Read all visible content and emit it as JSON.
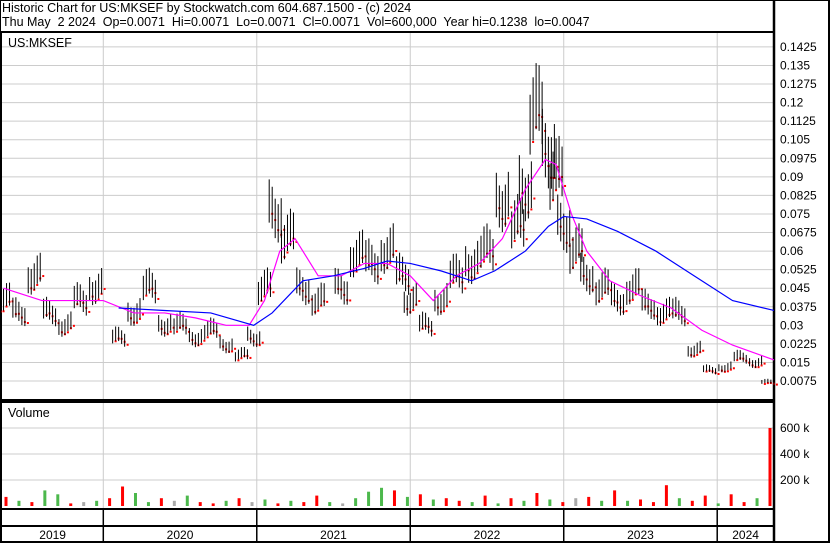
{
  "header": {
    "line1": "Historic Chart for US:MKSEF by Stockwatch.com 604.687.1500 - (c) 2024",
    "line2": "Thu May  2 2024  Op=0.0071  Hi=0.0071  Lo=0.0071  Cl=0.0071  Vol=600,000  Year hi=0.1238  lo=0.0047"
  },
  "chart_data": {
    "type": "line",
    "title": "US:MKSEF",
    "volume_title": "Volume",
    "x_range": [
      2019.34,
      2024.37
    ],
    "years": [
      "2019",
      "2020",
      "2021",
      "2022",
      "2023",
      "2024"
    ],
    "year_starts": [
      2020,
      2021,
      2022,
      2023,
      2024
    ],
    "y_range": [
      0,
      0.15
    ],
    "y_ticks": [
      "0.1425",
      "0.135",
      "0.1275",
      "0.12",
      "0.1125",
      "0.105",
      "0.0975",
      "0.09",
      "0.0825",
      "0.075",
      "0.0675",
      "0.06",
      "0.0525",
      "0.045",
      "0.0375",
      "0.03",
      "0.0225",
      "0.015",
      "0.0075"
    ],
    "volume_ticks": [
      "600 k",
      "400 k",
      "200 k"
    ],
    "volume_tick_values": [
      600,
      400,
      200
    ],
    "price": {
      "x": [
        2019.35,
        2019.45,
        2019.55,
        2019.65,
        2019.75,
        2019.85,
        2019.95,
        2020.1,
        2020.2,
        2020.3,
        2020.4,
        2020.5,
        2020.6,
        2020.7,
        2020.8,
        2020.9,
        2020.98,
        2021.05,
        2021.12,
        2021.2,
        2021.3,
        2021.4,
        2021.55,
        2021.65,
        2021.75,
        2021.85,
        2021.95,
        2022.0,
        2022.1,
        2022.2,
        2022.3,
        2022.4,
        2022.5,
        2022.6,
        2022.7,
        2022.75,
        2022.82,
        2022.9,
        2022.95,
        2023.0,
        2023.08,
        2023.15,
        2023.25,
        2023.35,
        2023.45,
        2023.55,
        2023.65,
        2023.75,
        2023.85,
        2023.95,
        2024.05,
        2024.15,
        2024.25,
        2024.33
      ],
      "close": [
        0.04,
        0.035,
        0.05,
        0.035,
        0.03,
        0.04,
        0.045,
        0.025,
        0.035,
        0.045,
        0.03,
        0.03,
        0.025,
        0.028,
        0.022,
        0.018,
        0.025,
        0.045,
        0.075,
        0.065,
        0.045,
        0.04,
        0.045,
        0.058,
        0.055,
        0.06,
        0.05,
        0.04,
        0.03,
        0.04,
        0.05,
        0.055,
        0.06,
        0.08,
        0.07,
        0.085,
        0.115,
        0.1,
        0.09,
        0.07,
        0.06,
        0.05,
        0.045,
        0.04,
        0.045,
        0.038,
        0.035,
        0.035,
        0.02,
        0.012,
        0.013,
        0.017,
        0.015,
        0.0071
      ]
    },
    "ma_short": {
      "color": "#ff00ff",
      "x": [
        2019.35,
        2019.6,
        2019.8,
        2020.0,
        2020.2,
        2020.4,
        2020.6,
        2020.8,
        2020.95,
        2021.05,
        2021.15,
        2021.25,
        2021.4,
        2021.55,
        2021.7,
        2021.85,
        2022.0,
        2022.15,
        2022.3,
        2022.45,
        2022.6,
        2022.75,
        2022.88,
        2022.95,
        2023.05,
        2023.15,
        2023.3,
        2023.5,
        2023.7,
        2023.9,
        2024.1,
        2024.37
      ],
      "y": [
        0.045,
        0.04,
        0.04,
        0.04,
        0.035,
        0.035,
        0.033,
        0.03,
        0.03,
        0.04,
        0.06,
        0.065,
        0.05,
        0.05,
        0.055,
        0.055,
        0.05,
        0.04,
        0.05,
        0.055,
        0.065,
        0.085,
        0.097,
        0.095,
        0.075,
        0.06,
        0.048,
        0.042,
        0.037,
        0.028,
        0.022,
        0.016
      ]
    },
    "ma_long": {
      "color": "#0000ff",
      "x": [
        2020.1,
        2020.4,
        2020.7,
        2020.98,
        2021.1,
        2021.3,
        2021.5,
        2021.7,
        2021.85,
        2022.0,
        2022.2,
        2022.4,
        2022.55,
        2022.75,
        2022.9,
        2023.0,
        2023.15,
        2023.35,
        2023.6,
        2023.85,
        2024.1,
        2024.37
      ],
      "y": [
        0.037,
        0.036,
        0.035,
        0.03,
        0.035,
        0.048,
        0.05,
        0.053,
        0.056,
        0.055,
        0.052,
        0.048,
        0.052,
        0.06,
        0.07,
        0.074,
        0.073,
        0.068,
        0.06,
        0.05,
        0.04,
        0.036
      ]
    },
    "volume_k": [
      70,
      40,
      30,
      120,
      90,
      20,
      30,
      40,
      60,
      150,
      100,
      30,
      60,
      40,
      80,
      30,
      20,
      40,
      60,
      30,
      50,
      20,
      40,
      30,
      80,
      30,
      20,
      60,
      110,
      140,
      120,
      70,
      90,
      50,
      60,
      40,
      30,
      80,
      20,
      60,
      40,
      100,
      50,
      30,
      60,
      70,
      40,
      120,
      40,
      50,
      30,
      160,
      60,
      40,
      80,
      20,
      90,
      30,
      60,
      600
    ],
    "volume_colors": [
      "r",
      "g",
      "r",
      "g",
      "g",
      "r",
      "x",
      "g",
      "r",
      "r",
      "g",
      "g",
      "r",
      "x",
      "g",
      "r",
      "r",
      "g",
      "r",
      "x",
      "g",
      "r",
      "g",
      "r",
      "r",
      "g",
      "x",
      "g",
      "g",
      "g",
      "r",
      "g",
      "r",
      "g",
      "r",
      "r",
      "g",
      "r",
      "g",
      "r",
      "g",
      "r",
      "g",
      "r",
      "x",
      "r",
      "g",
      "r",
      "g",
      "r",
      "r",
      "r",
      "g",
      "r",
      "r",
      "g",
      "r",
      "r",
      "g",
      "r"
    ]
  }
}
